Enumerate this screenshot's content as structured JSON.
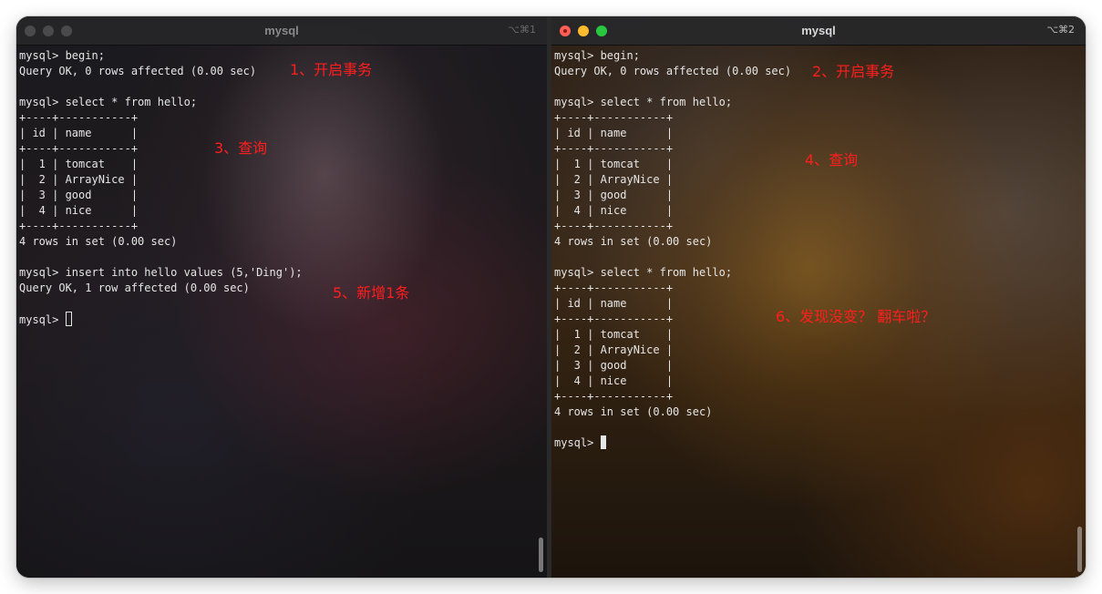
{
  "left_window": {
    "title": "mysql",
    "shortcut": "⌥⌘1",
    "lines": [
      "mysql> begin;",
      "Query OK, 0 rows affected (0.00 sec)",
      "",
      "mysql> select * from hello;",
      "+----+-----------+",
      "| id | name      |",
      "+----+-----------+",
      "|  1 | tomcat    |",
      "|  2 | ArrayNice |",
      "|  3 | good      |",
      "|  4 | nice      |",
      "+----+-----------+",
      "4 rows in set (0.00 sec)",
      "",
      "mysql> insert into hello values (5,'Ding');",
      "Query OK, 1 row affected (0.00 sec)",
      ""
    ],
    "prompt": "mysql> ",
    "annotations": [
      "1、开启事务",
      "3、查询",
      "5、新增1条"
    ]
  },
  "right_window": {
    "title": "mysql",
    "shortcut": "⌥⌘2",
    "lines": [
      "mysql> begin;",
      "Query OK, 0 rows affected (0.00 sec)",
      "",
      "mysql> select * from hello;",
      "+----+-----------+",
      "| id | name      |",
      "+----+-----------+",
      "|  1 | tomcat    |",
      "|  2 | ArrayNice |",
      "|  3 | good      |",
      "|  4 | nice      |",
      "+----+-----------+",
      "4 rows in set (0.00 sec)",
      "",
      "mysql> select * from hello;",
      "+----+-----------+",
      "| id | name      |",
      "+----+-----------+",
      "|  1 | tomcat    |",
      "|  2 | ArrayNice |",
      "|  3 | good      |",
      "|  4 | nice      |",
      "+----+-----------+",
      "4 rows in set (0.00 sec)",
      ""
    ],
    "prompt": "mysql> ",
    "annotations": [
      "2、开启事务",
      "4、查询",
      "6、发现没变？ 翻车啦？"
    ]
  },
  "colors": {
    "annotation": "#ff1e1e",
    "terminal_text": "#e6e6e6",
    "close_button": "#fe5f57",
    "minimize_button": "#febc2e",
    "zoom_button": "#28c840"
  }
}
